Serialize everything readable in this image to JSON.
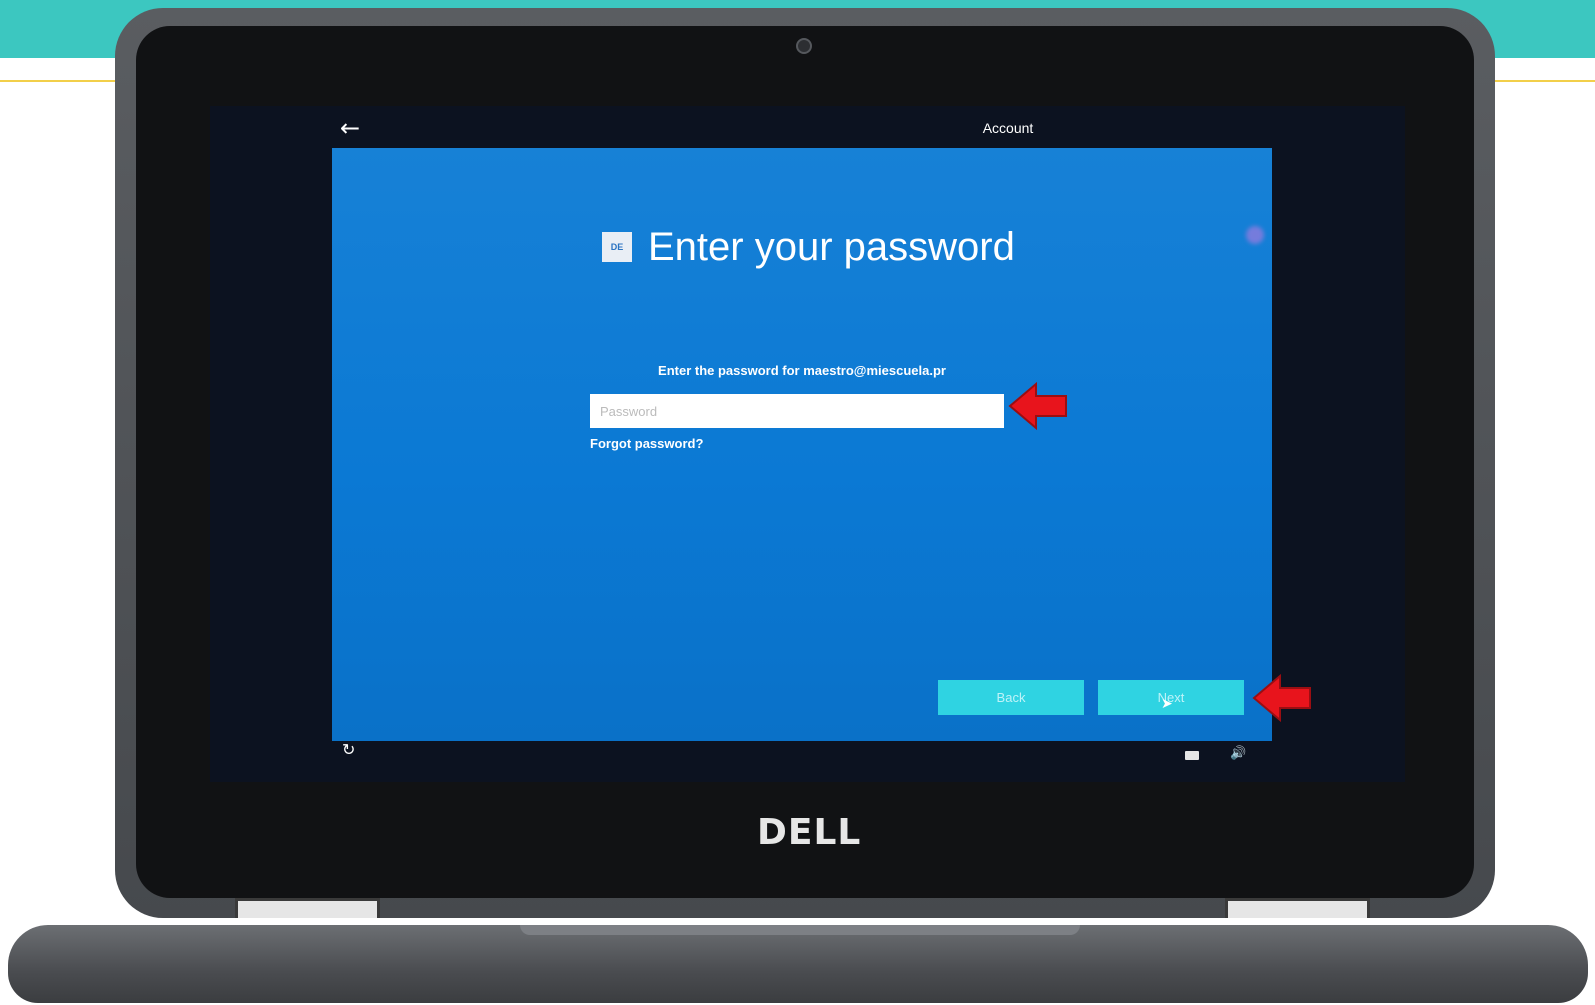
{
  "screen": {
    "tab_label": "Account",
    "heading": "Enter your password",
    "org_logo_text": "DE",
    "prompt": "Enter the password for maestro@miescuela.pr",
    "password_input": {
      "placeholder": "Password",
      "value": ""
    },
    "forgot_link": "Forgot password?",
    "back_button": "Back",
    "next_button": "Next"
  },
  "device": {
    "brand": "DELL"
  },
  "colors": {
    "accent_band": "#3cc7c0",
    "oobe_blue": "#0b79d4",
    "button_cyan": "#2fd3e2",
    "annotation_red": "#e8141c"
  },
  "icons": [
    "back-arrow-icon",
    "power-icon",
    "keyboard-icon",
    "volume-icon",
    "mouse-cursor-icon",
    "red-pointer-arrow-icon"
  ]
}
